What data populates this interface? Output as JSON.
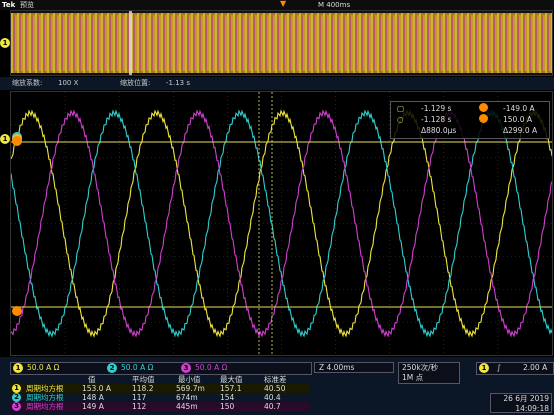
{
  "topbar": {
    "brand": "Tek",
    "mode": "预览",
    "timebase": "M 400ms"
  },
  "zoom": {
    "factor_label": "缩放系数:",
    "factor": "100 X",
    "position_label": "缩放位置:",
    "position": "-1.13 s"
  },
  "cursor_readout": {
    "t1": "-1.129 s",
    "a1": "-149.0 A",
    "t2": "-1.128 s",
    "a2": "150.0 A",
    "dt": "Δ880.0μs",
    "da": "Δ299.0 A"
  },
  "channels": [
    {
      "num": "1",
      "scale": "50.0 A Ω",
      "color": "#f0e640"
    },
    {
      "num": "2",
      "scale": "50.0 A Ω",
      "color": "#30d0d0"
    },
    {
      "num": "3",
      "scale": "50.0 A Ω",
      "color": "#d040d0"
    }
  ],
  "timebase_box": {
    "value": "Z 4.00ms"
  },
  "acq_box": {
    "rate": "250k次/秒",
    "points": "1M 点"
  },
  "trigger_box": {
    "ch": "1",
    "slope": "∫",
    "level": "2.00 A"
  },
  "datetime": {
    "date": "26 6月 2019",
    "time": "14:09:18"
  },
  "measurements": {
    "headers": [
      "值",
      "平均值",
      "最小值",
      "最大值",
      "标准差"
    ],
    "rows": [
      {
        "ch": "1",
        "name": "周期均方根",
        "values": [
          "153.0 A",
          "118.2",
          "569.7m",
          "157.1",
          "40.50"
        ]
      },
      {
        "ch": "2",
        "name": "周期均方根",
        "values": [
          "148 A",
          "117",
          "674m",
          "154",
          "40.4"
        ]
      },
      {
        "ch": "3",
        "name": "周期均方根",
        "values": [
          "149 A",
          "112",
          "445m",
          "150",
          "40.7"
        ]
      }
    ]
  },
  "colors": {
    "ch1": "#f0e640",
    "ch2": "#30d0d0",
    "ch3": "#d040d0",
    "cursor": "#ff8a00"
  }
}
